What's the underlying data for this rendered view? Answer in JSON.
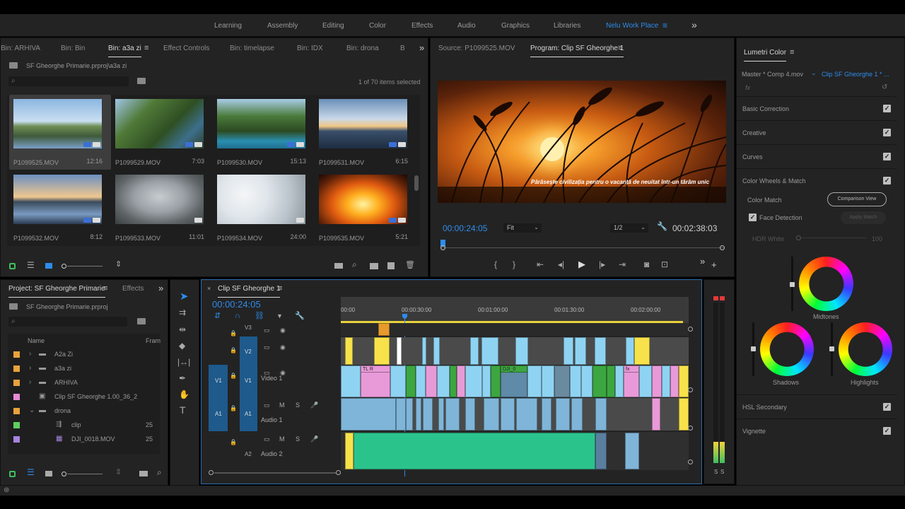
{
  "workspaces": {
    "items": [
      "Learning",
      "Assembly",
      "Editing",
      "Color",
      "Effects",
      "Audio",
      "Graphics",
      "Libraries"
    ],
    "active": "Nelu Work Place",
    "more": "»"
  },
  "bins_panel": {
    "tabs": [
      "Bin: ARHIVA",
      "Bin: Bin",
      "Bin: a3a zi",
      "Effect Controls",
      "Bin: timelapse",
      "Bin: IDX",
      "Bin: drona",
      "B"
    ],
    "active_tab": "Bin: a3a zi",
    "path": "SF Gheorghe Primarie.prproj\\a3a zi",
    "selection": "1 of 70 items selected",
    "clips": [
      {
        "name": "P1099525.MOV",
        "dur": "12:16"
      },
      {
        "name": "P1099529.MOV",
        "dur": "7:03"
      },
      {
        "name": "P1099530.MOV",
        "dur": "15:13"
      },
      {
        "name": "P1099531.MOV",
        "dur": "6:15"
      },
      {
        "name": "P1099532.MOV",
        "dur": "8:12"
      },
      {
        "name": "P1099533.MOV",
        "dur": "11:01"
      },
      {
        "name": "P1099534.MOV",
        "dur": "24:00"
      },
      {
        "name": "P1099535.MOV",
        "dur": "5:21"
      }
    ]
  },
  "program": {
    "source_tab": "Source: P1099525.MOV",
    "program_tab": "Program: Clip SF Gheorghe 1",
    "subtitle": "Părăsește civilizația pentru o vacanță  de neuitat într-un tărâm unic",
    "timecode": "00:00:24:05",
    "fit": "Fit",
    "resolution": "1/2",
    "duration": "00:02:38:03"
  },
  "lumetri": {
    "title": "Lumetri Color",
    "master": "Master * Comp 4.mov",
    "clip": "Clip SF Gheorghe 1 * ...",
    "fx": "fx",
    "sections": [
      "Basic Correction",
      "Creative",
      "Curves",
      "Color Wheels & Match"
    ],
    "color_match": "Color Match",
    "comparison_view": "Comparison View",
    "face_detection": "Face Detection",
    "apply_match": "Apply Match",
    "hdr_white": "HDR White",
    "hdr_value": "100",
    "wheels": [
      "Midtones",
      "Shadows",
      "Highlights"
    ],
    "bottom_sections": [
      "HSL Secondary",
      "Vignette"
    ]
  },
  "project": {
    "tab": "Project: SF Gheorghe Primarie",
    "effects_tab": "Effects",
    "file": "SF Gheorghe Primarie.prproj",
    "col_name": "Name",
    "col_frame": "Fram",
    "items": [
      {
        "name": "A2a Zi",
        "color": "#e8a33a",
        "type": "folder",
        "expand": "›",
        "val": ""
      },
      {
        "name": "a3a zi",
        "color": "#e8a33a",
        "type": "folder",
        "expand": "›",
        "val": ""
      },
      {
        "name": "ARHIVA",
        "color": "#e8a33a",
        "type": "folder",
        "expand": "›",
        "val": ""
      },
      {
        "name": "Clip SF Gheorghe 1.00_36_2",
        "color": "#e88ad8",
        "type": "seq",
        "expand": "",
        "val": ""
      },
      {
        "name": "drona",
        "color": "#e8a33a",
        "type": "folder",
        "expand": "⌄",
        "val": ""
      },
      {
        "name": "clip",
        "color": "#5fcf5f",
        "type": "seq2",
        "expand": "",
        "val": "25"
      },
      {
        "name": "DJI_0018.MOV",
        "color": "#a884e0",
        "type": "video",
        "expand": "",
        "val": "25"
      }
    ]
  },
  "timeline": {
    "tab": "Clip SF Gheorghe 1",
    "timecode": "00:00:24:05",
    "ruler": [
      "00:00",
      "00:00:30:00",
      "00:01:00:00",
      "00:01:30:00",
      "00:02:00:00"
    ],
    "tracks": [
      {
        "id": "V3",
        "name": ""
      },
      {
        "id": "V2",
        "name": ""
      },
      {
        "id": "V1",
        "name": "Video 1",
        "src": "V1"
      },
      {
        "id": "A1",
        "name": "Audio 1",
        "src": "A1"
      },
      {
        "id": "A2",
        "name": "Audio 2"
      }
    ],
    "clip_labels": [
      "TL R",
      "DJI_0",
      "fx"
    ],
    "meter": [
      "S",
      "S"
    ]
  },
  "colors": {
    "accent": "#2d8ceb",
    "video_clip": "#8fd3f2",
    "audio_clip": "#7fb5d8",
    "audio2_clip": "#2bc38c",
    "yellow_clip": "#f7e24b",
    "pink_clip": "#e89ad8",
    "green_clip": "#3ca640"
  }
}
